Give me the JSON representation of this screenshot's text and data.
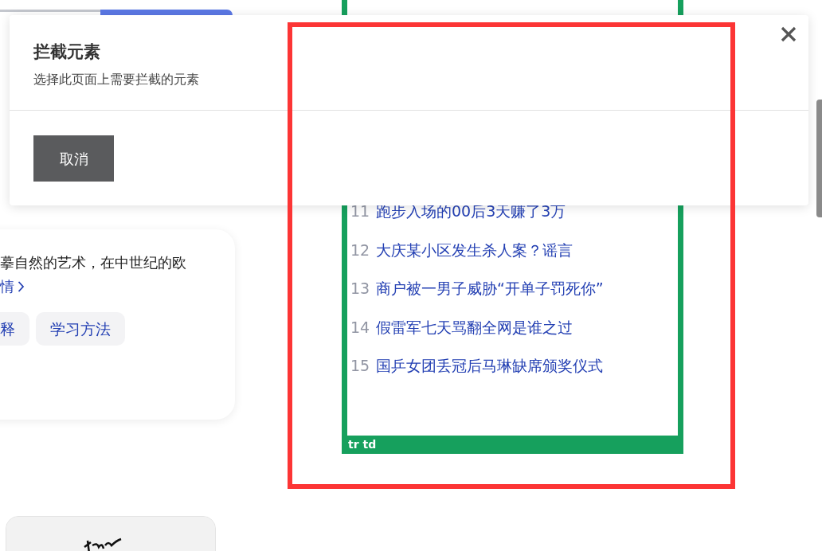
{
  "info_card": {
    "text": "摹自然的艺术，在中世纪的欧",
    "link": "情",
    "tags": [
      "释",
      "学习方法"
    ]
  },
  "hot_list": [
    {
      "rank": "11",
      "title": "跑步入场的00后3天赚了3万"
    },
    {
      "rank": "12",
      "title": "大庆某小区发生杀人案？谣言"
    },
    {
      "rank": "13",
      "title": "商户被一男子威胁“开单子罚死你”"
    },
    {
      "rank": "14",
      "title": "假雷军七天骂翻全网是谁之过"
    },
    {
      "rank": "15",
      "title": "国乒女团丢冠后马琳缺席颁奖仪式"
    }
  ],
  "highlight_label": "tr td",
  "dialog": {
    "title": "拦截元素",
    "subtitle": "选择此页面上需要拦截的元素",
    "buttons": [
      "取消"
    ]
  }
}
